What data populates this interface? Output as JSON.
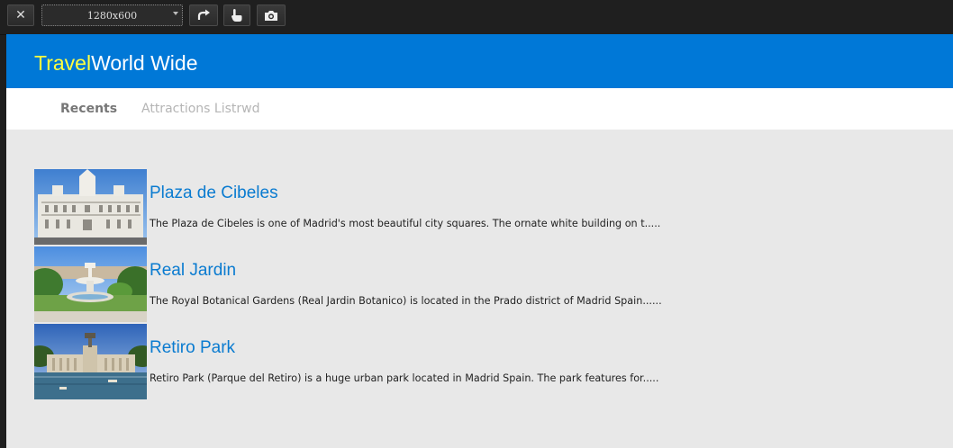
{
  "toolbar": {
    "close_icon": "close-icon",
    "resolution": "1280x600",
    "rotate_icon": "rotate-icon",
    "touch_icon": "touch-hand-icon",
    "screenshot_icon": "camera-icon"
  },
  "app": {
    "brand_part1": "Travel",
    "brand_part2": "World Wide",
    "colors": {
      "header": "#0078d7",
      "brand_accent": "#ffff40",
      "title_link": "#0a7bd0",
      "background": "#e8e8e8"
    }
  },
  "nav": {
    "tabs": [
      {
        "label": "Recents",
        "active": true
      },
      {
        "label": "Attractions Listrwd",
        "active": false
      }
    ]
  },
  "attractions": [
    {
      "title": "Plaza de Cibeles",
      "description": "The Plaza de Cibeles is one of Madrid's most beautiful city squares. The ornate white building on t....."
    },
    {
      "title": "Real Jardin",
      "description": "The Royal Botanical Gardens (Real Jardin Botanico) is located in the Prado district of Madrid Spain......"
    },
    {
      "title": "Retiro Park",
      "description": "Retiro Park (Parque del Retiro) is a huge urban park located in Madrid Spain. The park features for....."
    }
  ]
}
